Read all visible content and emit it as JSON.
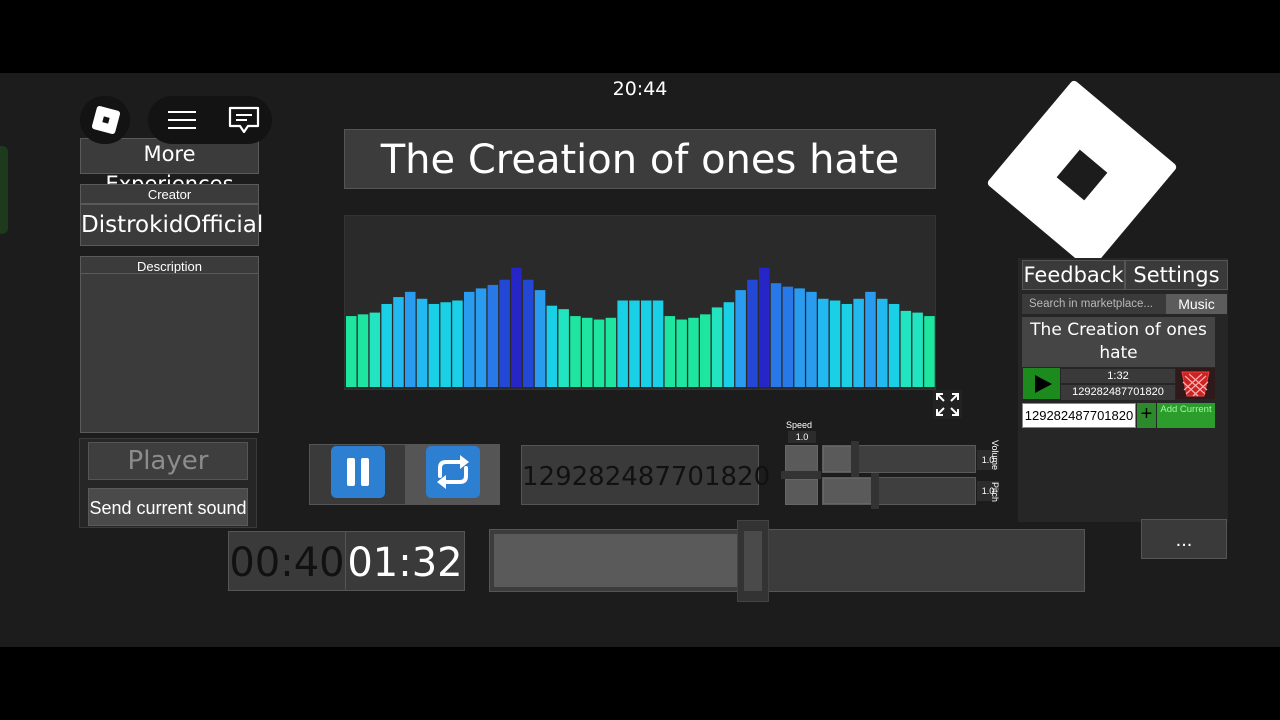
{
  "status": {
    "clock": "20:44"
  },
  "left_panel": {
    "more_experiences": "More Experiences",
    "creator_label": "Creator",
    "creator_name": "DistrokidOfficial",
    "description_label": "Description",
    "player_name_placeholder": "Player name",
    "send_button": "Send current sound"
  },
  "player": {
    "song_title": "The Creation of ones hate",
    "sound_id": "129282487701820",
    "current_time": "00:40",
    "total_time": "01:32",
    "progress": 0.437,
    "speed_label": "Speed",
    "speed_value": "1.0",
    "volume_label": "Volume",
    "volume_value": "1.0",
    "pitch_label": "Pitch",
    "pitch_value": "1.0"
  },
  "visualizer": {
    "levels": [
      0.41,
      0.42,
      0.43,
      0.48,
      0.52,
      0.55,
      0.51,
      0.48,
      0.49,
      0.5,
      0.55,
      0.57,
      0.59,
      0.62,
      0.69,
      0.62,
      0.56,
      0.47,
      0.45,
      0.41,
      0.4,
      0.39,
      0.4,
      0.5,
      0.5,
      0.5,
      0.5,
      0.41,
      0.39,
      0.4,
      0.42,
      0.46,
      0.49,
      0.56,
      0.62,
      0.69,
      0.6,
      0.58,
      0.57,
      0.55,
      0.51,
      0.5,
      0.48,
      0.51,
      0.55,
      0.51,
      0.48,
      0.44,
      0.43,
      0.41
    ],
    "colors": [
      "#1ee6a0",
      "#22e4c0",
      "#1ad0e6",
      "#22b8f0",
      "#2a9cf0",
      "#2878e8",
      "#2448d6",
      "#2626c8"
    ]
  },
  "right_panel": {
    "feedback_tab": "Feedback",
    "settings_tab": "Settings",
    "search_placeholder": "Search in marketplace...",
    "music_tab": "Music",
    "card_title": "The Creation of ones hate",
    "card_duration": "1:32",
    "card_id": "129282487701820",
    "id_input_value": "129282487701820",
    "plus": "+",
    "add_current": "Add Current",
    "more_button": "..."
  }
}
